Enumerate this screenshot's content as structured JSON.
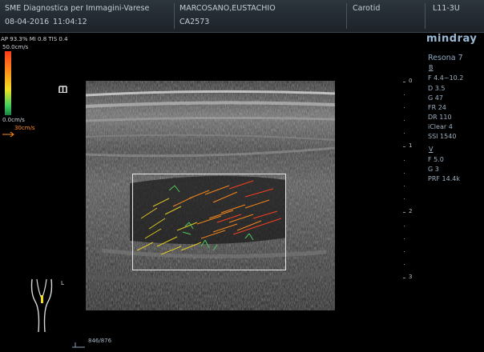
{
  "header": {
    "institution": "SME Diagnostica per Immagini-Varese",
    "date": "08-04-2016",
    "time": "11:04:12",
    "patient_name": "MARCOSANO,EUSTACHIO",
    "patient_id": "CA2573",
    "exam": "Carotid",
    "probe": "L11-3U"
  },
  "overlay": {
    "ap_mi_tis": "AP 93.3%  MI 0.8  TIS 0.4",
    "scale_top": "50.0cm/s",
    "scale_bottom": "0.0cm/s",
    "arrow_speed": "30cm/s",
    "frame_counter": "846/876",
    "body_mark_label": "L"
  },
  "right_panel": {
    "brand": "mindray",
    "model": "Resona 7",
    "b_mode_label": "B",
    "b_params": [
      "F 4.4~10.2",
      "D 3.5",
      "G 47",
      "FR 24",
      "DR 110",
      "iClear 4",
      "SSI 1540"
    ],
    "v_mode_label": "V",
    "v_params": [
      "F 5.0",
      "G 3",
      "PRF 14.4k"
    ]
  },
  "depth_scale": [
    "0",
    "1",
    "2",
    "3"
  ],
  "colors": {
    "header_bg": "#252c33",
    "panel_text": "#9fb0c0",
    "orange_arrow": "#ff8c1a"
  }
}
